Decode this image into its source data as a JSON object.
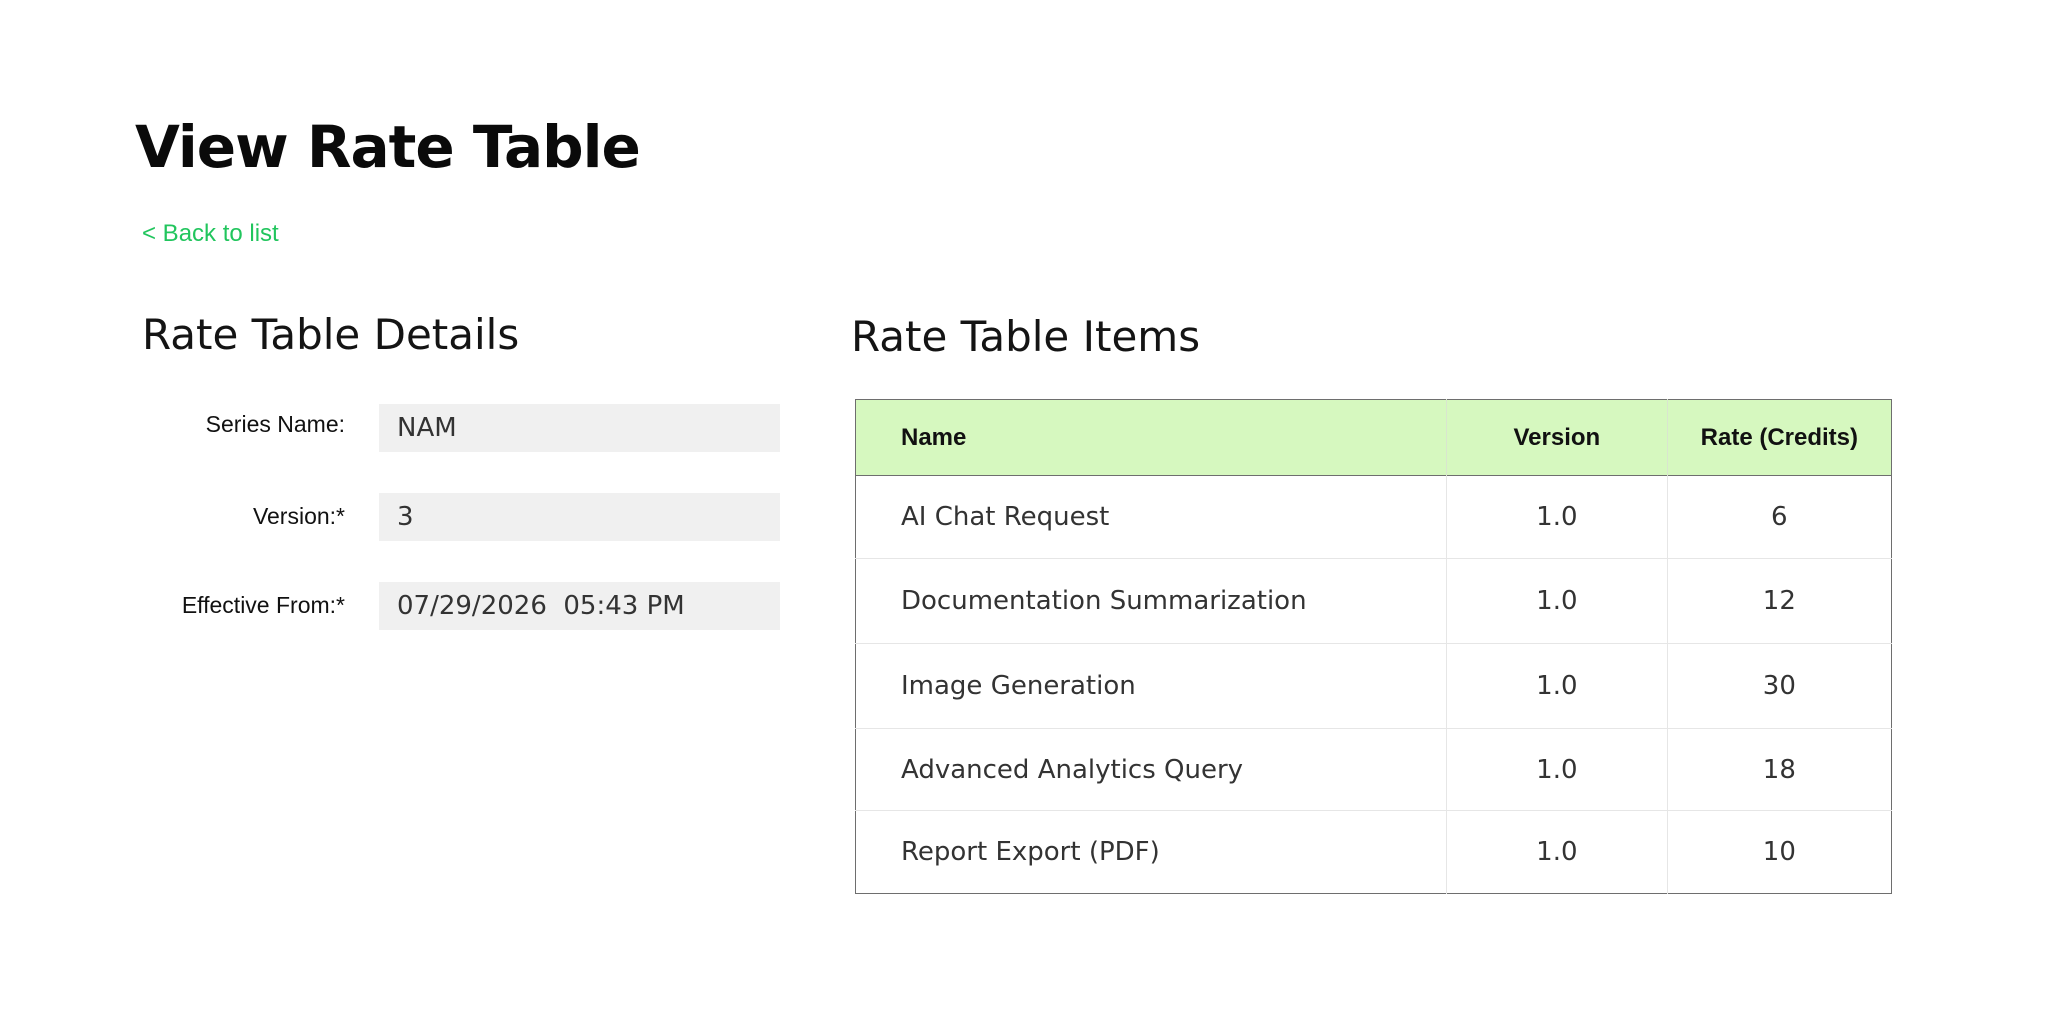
{
  "page": {
    "title": "View Rate Table",
    "back_link": "< Back to list"
  },
  "details": {
    "title": "Rate Table Details",
    "fields": [
      {
        "label": "Series Name:",
        "value": "NAM"
      },
      {
        "label": "Version:*",
        "value": "3"
      },
      {
        "label": "Effective From:*",
        "value": "07/29/2026  05:43 PM"
      }
    ]
  },
  "items": {
    "title": "Rate Table Items",
    "columns": [
      "Name",
      "Version",
      "Rate (Credits)"
    ],
    "rows": [
      {
        "name": "AI Chat Request",
        "version": "1.0",
        "rate": "6"
      },
      {
        "name": "Documentation Summarization",
        "version": "1.0",
        "rate": "12"
      },
      {
        "name": "Image Generation",
        "version": "1.0",
        "rate": "30"
      },
      {
        "name": "Advanced Analytics Query",
        "version": "1.0",
        "rate": "18"
      },
      {
        "name": "Report Export (PDF)",
        "version": "1.0",
        "rate": "10"
      }
    ]
  },
  "colors": {
    "accent": "#21c55d",
    "table_header_bg": "#d6f8bf",
    "input_bg": "#f0f0f0"
  }
}
